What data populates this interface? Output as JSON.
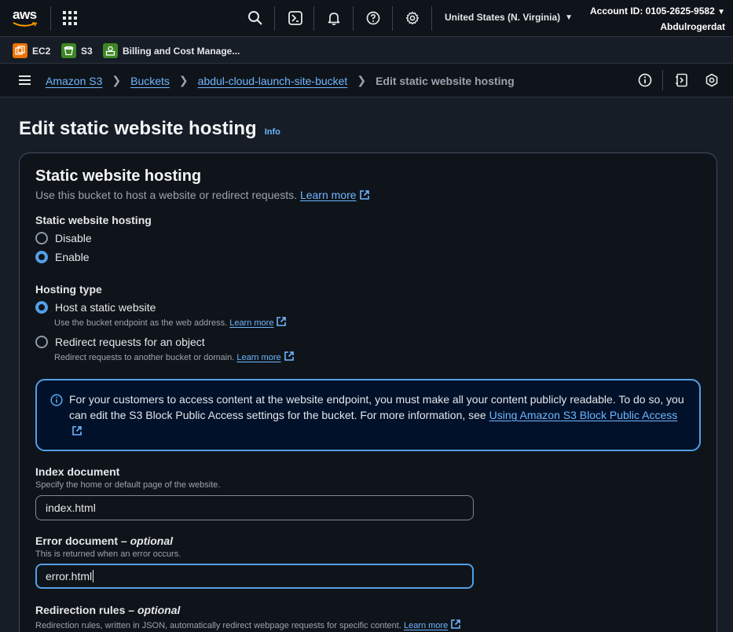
{
  "topnav": {
    "logo_text": "aws",
    "region": "United States (N. Virginia)",
    "account_id": "Account ID: 0105-2625-9582",
    "username": "Abdulrogerdat"
  },
  "favorites": [
    {
      "label": "EC2",
      "color": "#ed7100"
    },
    {
      "label": "S3",
      "color": "#3f8624"
    },
    {
      "label": "Billing and Cost Manage...",
      "color": "#3f8624"
    }
  ],
  "breadcrumb": {
    "items": [
      "Amazon S3",
      "Buckets",
      "abdul-cloud-launch-site-bucket"
    ],
    "current": "Edit static website hosting"
  },
  "page": {
    "title": "Edit static website hosting",
    "info": "Info"
  },
  "panel": {
    "title": "Static website hosting",
    "description": "Use this bucket to host a website or redirect requests.",
    "learn_more": "Learn more",
    "hosting_label": "Static website hosting",
    "hosting_options": [
      "Disable",
      "Enable"
    ],
    "hosting_selected": "Enable",
    "hosting_type_label": "Hosting type",
    "type_options": [
      {
        "label": "Host a static website",
        "desc": "Use the bucket endpoint as the web address.",
        "link": "Learn more"
      },
      {
        "label": "Redirect requests for an object",
        "desc": "Redirect requests to another bucket or domain.",
        "link": "Learn more"
      }
    ],
    "type_selected": "Host a static website",
    "alert_text": "For your customers to access content at the website endpoint, you must make all your content publicly readable. To do so, you can edit the S3 Block Public Access settings for the bucket. For more information, see",
    "alert_link": "Using Amazon S3 Block Public Access",
    "index_label": "Index document",
    "index_hint": "Specify the home or default page of the website.",
    "index_value": "index.html",
    "error_label": "Error document",
    "error_optional": "optional",
    "error_hint": "This is returned when an error occurs.",
    "error_value": "error.html",
    "redirect_label": "Redirection rules",
    "redirect_optional": "optional",
    "redirect_hint": "Redirection rules, written in JSON, automatically redirect webpage requests for specific content.",
    "redirect_link": "Learn more"
  },
  "colors": {
    "accent": "#539fe5",
    "link": "#6fb6ff",
    "background": "#161d26",
    "surface": "#0f141a"
  }
}
